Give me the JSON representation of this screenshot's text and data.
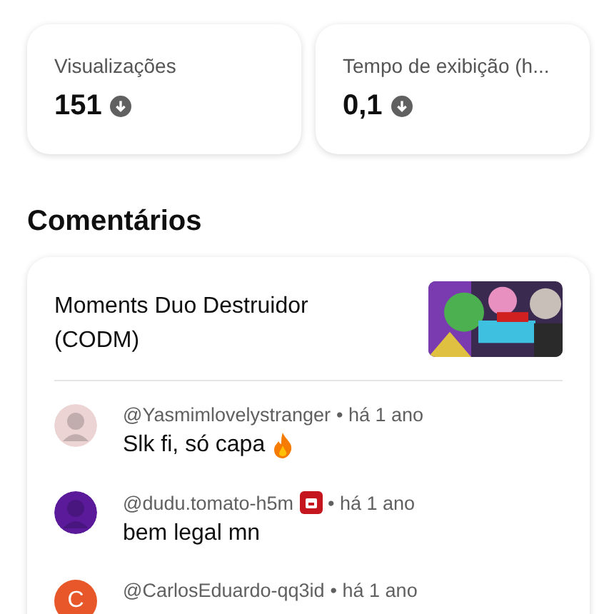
{
  "stats": [
    {
      "label": "Visualizações",
      "value": "151"
    },
    {
      "label": "Tempo de exibição (h...",
      "value": "0,1"
    }
  ],
  "comments_section": {
    "title": "Comentários",
    "video_title": "Moments Duo Destruidor (CODM)",
    "comments": [
      {
        "author": "@Yasmimlovelystranger",
        "time": "• há 1 ano",
        "text": "Slk fi, só capa",
        "fire": true,
        "badge": false
      },
      {
        "author": "@dudu.tomato-h5m",
        "time": "• há 1 ano",
        "text": "bem legal mn",
        "fire": false,
        "badge": true
      },
      {
        "author": "@CarlosEduardo-qq3id",
        "time": "• há 1 ano",
        "badge": false,
        "avatar": {
          "kind": "letter",
          "letter": "C",
          "color": "#e8572a"
        }
      }
    ]
  }
}
